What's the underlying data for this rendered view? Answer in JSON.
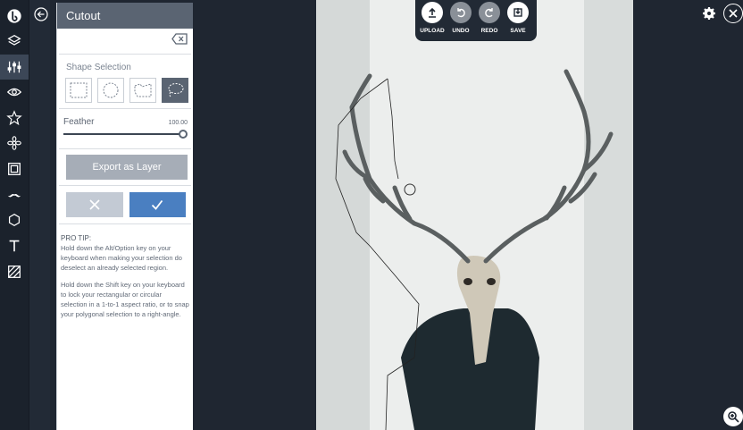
{
  "panel": {
    "title": "Cutout",
    "shape_selection_title": "Shape Selection",
    "shapes": [
      "rectangle",
      "ellipse",
      "polygonal-lasso",
      "freehand-lasso"
    ],
    "selected_shape": "freehand-lasso",
    "feather_label": "Feather",
    "feather_value": "100.00",
    "feather_fraction": 1.0,
    "export_label": "Export as Layer",
    "tip_title": "PRO TIP:",
    "tip_1": "Hold down the Alt/Option key on your keyboard when making your selection do deselect an already selected region.",
    "tip_2": "Hold down the Shift key on your keyboard to lock your rectangular or circular selection in a 1-to-1 aspect ratio, or to snap your polygonal selection to a right-angle."
  },
  "toolbar": {
    "upload": "UPLOAD",
    "undo": "UNDO",
    "redo": "REDO",
    "save": "SAVE"
  },
  "rail": {
    "icons": [
      "logo-icon",
      "layers-icon",
      "adjustments-icon",
      "eye-icon",
      "star-icon",
      "flower-icon",
      "frame-icon",
      "mustache-icon",
      "shape-icon",
      "text-icon",
      "texture-icon"
    ],
    "active": "adjustments-icon"
  },
  "colors": {
    "accent": "#4a7fc1",
    "panel_header": "#5a6472",
    "background": "#1f2631"
  }
}
